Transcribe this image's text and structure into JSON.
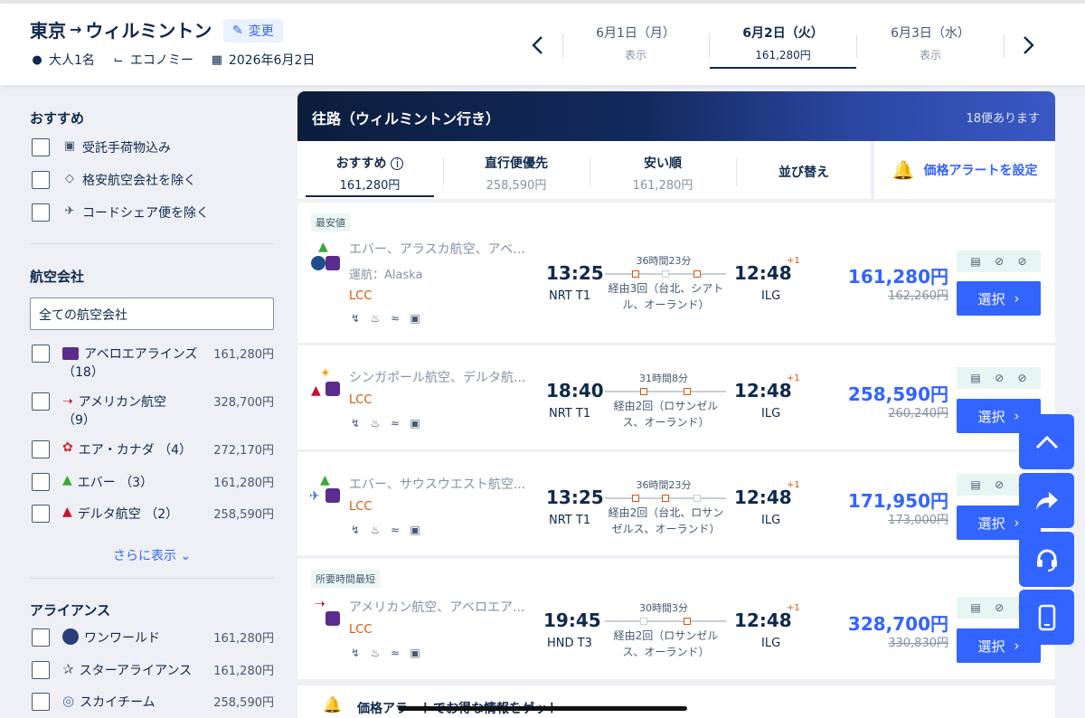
{
  "header": {
    "origin": "東京",
    "destination": "ウィルミントン",
    "change_label": "変更",
    "passengers": "大人1名",
    "cabin": "エコノミー",
    "date": "2026年6月2日"
  },
  "date_tabs": [
    {
      "date": "6月1日（月）",
      "sub": "表示",
      "active": false
    },
    {
      "date": "6月2日（火）",
      "sub": "161,280円",
      "active": true
    },
    {
      "date": "6月3日（水）",
      "sub": "表示",
      "active": false
    }
  ],
  "sidebar": {
    "recommend_heading": "おすすめ",
    "recommend_items": [
      "受託手荷物込み",
      "格安航空会社を除く",
      "コードシェア便を除く"
    ],
    "airline_heading": "航空会社",
    "airline_select": "全ての航空会社",
    "airlines": [
      {
        "name": "アベロエアラインズ",
        "count": "（18）",
        "price": "161,280円"
      },
      {
        "name": "アメリカン航空",
        "count": "（9）",
        "price": "328,700円"
      },
      {
        "name": "エア・カナダ （4）",
        "count": "",
        "price": "272,170円"
      },
      {
        "name": "エバー （3）",
        "count": "",
        "price": "161,280円"
      },
      {
        "name": "デルタ航空 （2）",
        "count": "",
        "price": "258,590円"
      }
    ],
    "more_label": "さらに表示",
    "alliance_heading": "アライアンス",
    "alliances": [
      {
        "name": "ワンワールド",
        "price": "161,280円"
      },
      {
        "name": "スターアライアンス",
        "price": "161,280円"
      },
      {
        "name": "スカイチーム",
        "price": "258,590円"
      }
    ]
  },
  "banner": {
    "title": "往路（ウィルミントン行き）",
    "count": "18便あります"
  },
  "sort_tabs": [
    {
      "title": "おすすめ",
      "price": "161,280円",
      "active": true
    },
    {
      "title": "直行便優先",
      "price": "258,590円",
      "active": false
    },
    {
      "title": "安い順",
      "price": "161,280円",
      "active": false
    },
    {
      "title": "並び替え",
      "price": "",
      "active": false
    }
  ],
  "alert_label": "価格アラートを設定",
  "flights": [
    {
      "tag": "最安値",
      "airlines": "エバー、アラスカ航空、アベ...",
      "operated": "運航：Alaska",
      "lcc": "LCC",
      "dep_time": "13:25",
      "dep_airport": "NRT T1",
      "duration": "36時間23分",
      "stops": "経由3回（台北、シアト\nル、オーランド）",
      "arr_time": "12:48",
      "arr_airport": "ILG",
      "plus": "+1",
      "price": "161,280円",
      "old_price": "162,260円",
      "select": "選択"
    },
    {
      "tag": "",
      "airlines": "シンガポール航空、デルタ航...",
      "operated": "",
      "lcc": "LCC",
      "dep_time": "18:40",
      "dep_airport": "NRT T1",
      "duration": "31時間8分",
      "stops": "経由2回（ロサンゼル\nス、オーランド）",
      "arr_time": "12:48",
      "arr_airport": "ILG",
      "plus": "+1",
      "price": "258,590円",
      "old_price": "260,240円",
      "select": "選択"
    },
    {
      "tag": "",
      "airlines": "エバー、サウスウエスト航空...",
      "operated": "",
      "lcc": "LCC",
      "dep_time": "13:25",
      "dep_airport": "NRT T1",
      "duration": "36時間23分",
      "stops": "経由2回（台北、ロサン\nゼルス、オーランド）",
      "arr_time": "12:48",
      "arr_airport": "ILG",
      "plus": "+1",
      "price": "171,950円",
      "old_price": "173,000円",
      "select": "選択"
    },
    {
      "tag": "所要時間最短",
      "airlines": "アメリカン航空、アベロエア...",
      "operated": "",
      "lcc": "LCC",
      "dep_time": "19:45",
      "dep_airport": "HND T3",
      "duration": "30時間3分",
      "stops": "経由2回（ロサンゼル\nス、オーランド）",
      "arr_time": "12:48",
      "arr_airport": "ILG",
      "plus": "+1",
      "price": "328,700円",
      "old_price": "330,830円",
      "select": "選択"
    }
  ],
  "bottom_card": "価格アラートでお得な情報をゲット",
  "colors": {
    "accent": "#3264ff",
    "navy": "#0f294d",
    "lcc": "#d9540b"
  }
}
